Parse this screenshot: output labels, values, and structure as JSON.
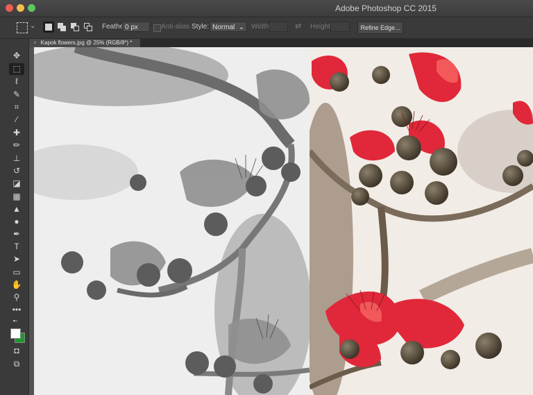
{
  "window": {
    "title": "Adobe Photoshop CC 2015"
  },
  "options_bar": {
    "feather_label": "Feather:",
    "feather_value": "0 px",
    "antialias_label": "Anti-alias",
    "style_label": "Style:",
    "style_value": "Normal",
    "width_label": "Width:",
    "height_label": "Height:",
    "refine_edge_label": "Refine Edge..."
  },
  "document_tab": {
    "title": "Kapok flowers.jpg @ 25% (RGB/8*) *"
  },
  "tools": [
    "move",
    "rectangular-marquee",
    "lasso",
    "quick-selection",
    "crop",
    "eyedropper",
    "spot-healing-brush",
    "brush",
    "clone-stamp",
    "history-brush",
    "eraser",
    "gradient",
    "blur",
    "dodge",
    "pen",
    "type",
    "path-selection",
    "rectangle",
    "hand",
    "zoom",
    "edit-toolbar",
    "quick-mask",
    "screen-mode"
  ],
  "colors": {
    "foreground": "#ffffff",
    "background": "#1a9a2a",
    "flower_red": "#e0283a",
    "ui_dark": "#3a3a3a"
  }
}
